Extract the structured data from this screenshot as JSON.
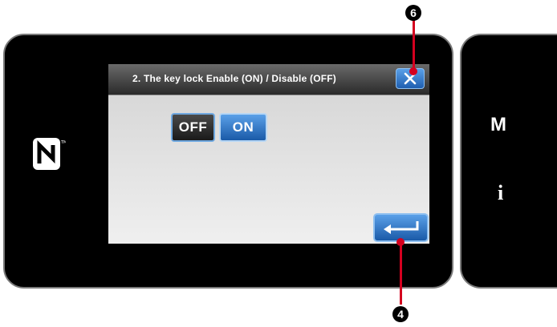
{
  "dialog": {
    "title": "2.   The key lock Enable (ON) / Disable (OFF)",
    "close_icon": "close-x-icon"
  },
  "toggle": {
    "off_label": "OFF",
    "on_label": "ON",
    "selected": "ON"
  },
  "enter_button": {
    "icon": "enter-return-icon"
  },
  "side_panel": {
    "mode_label": "M",
    "info_label": "i"
  },
  "nfc_icon": "nfc-logo-icon",
  "callouts": {
    "close": "6",
    "enter": "4"
  },
  "colors": {
    "accent_blue": "#2a74c8",
    "callout_red": "#d4001f",
    "bezel": "#000000"
  }
}
